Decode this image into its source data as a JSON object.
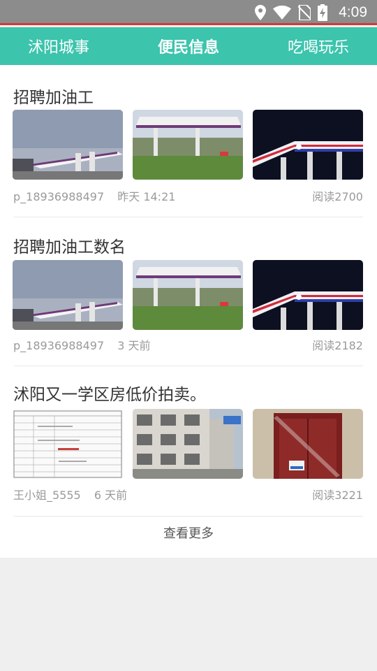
{
  "status": {
    "time": "4:09"
  },
  "tabs": [
    {
      "label": "沭阳城事"
    },
    {
      "label": "便民信息"
    },
    {
      "label": "吃喝玩乐"
    }
  ],
  "posts": [
    {
      "title": "招聘加油工",
      "author": "p_18936988497",
      "time": "昨天 14:21",
      "reads": "阅读2700"
    },
    {
      "title": "招聘加油工数名",
      "author": "p_18936988497",
      "time": "3 天前",
      "reads": "阅读2182"
    },
    {
      "title": "沭阳又一学区房低价拍卖。",
      "author": "王小姐_5555",
      "time": "6 天前",
      "reads": "阅读3221"
    }
  ],
  "more_label": "查看更多",
  "colors": {
    "accent": "#3cc4ad",
    "statusbar": "#8c8c8c",
    "status_line": "#d03a36"
  }
}
